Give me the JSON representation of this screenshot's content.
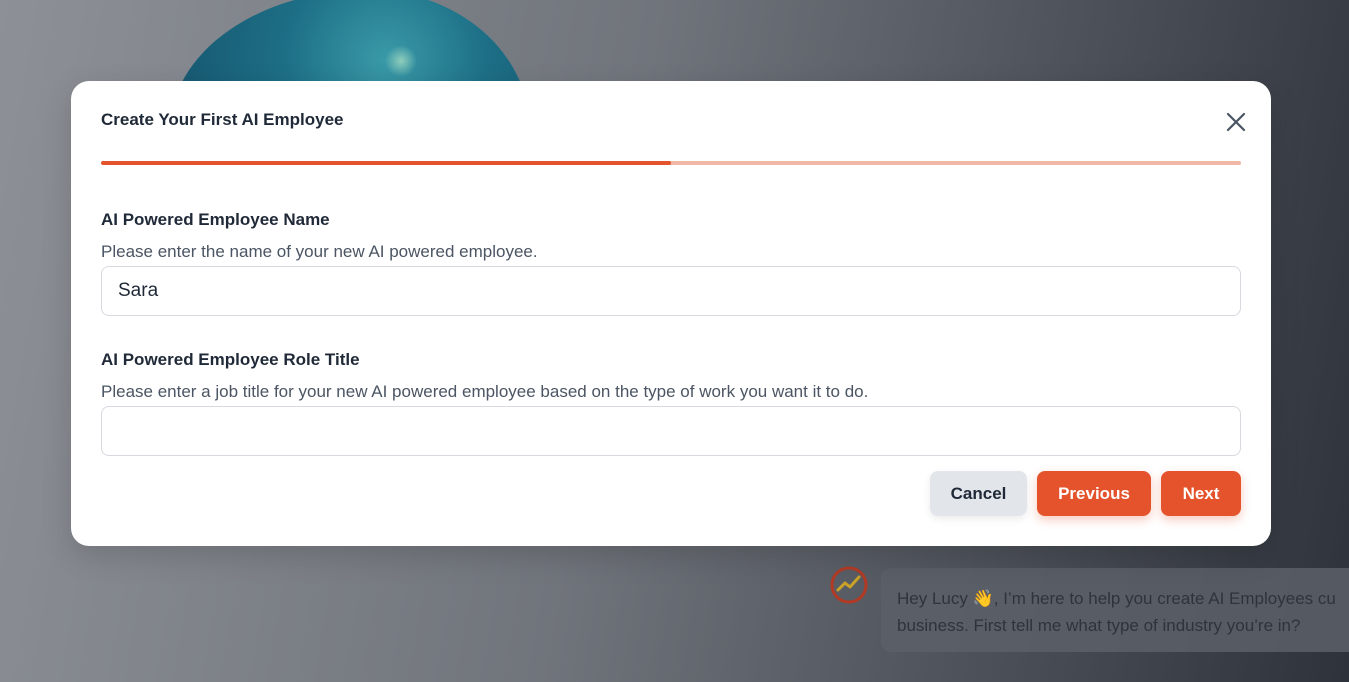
{
  "modal": {
    "title": "Create Your First AI Employee",
    "progress": 0.5,
    "name_field": {
      "label": "AI Powered Employee Name",
      "help": "Please enter the name of your new AI powered employee.",
      "value": "Sara",
      "placeholder": ""
    },
    "role_field": {
      "label": "AI Powered Employee Role Title",
      "help": "Please enter a job title for your new AI powered employee based on the type of work you want it to do.",
      "value": "",
      "placeholder": ""
    },
    "buttons": {
      "cancel": "Cancel",
      "previous": "Previous",
      "next": "Next"
    }
  },
  "chat": {
    "avatar_icon": "assistant-logo-icon",
    "line1": "Hey Lucy 👋, I’m here to help you create AI Employees cu",
    "line2": "business. First tell me what type of industry you’re in?"
  },
  "colors": {
    "accent": "#e4532b",
    "accent_light": "#f2b8a7",
    "cancel_bg": "#e2e5ea"
  }
}
